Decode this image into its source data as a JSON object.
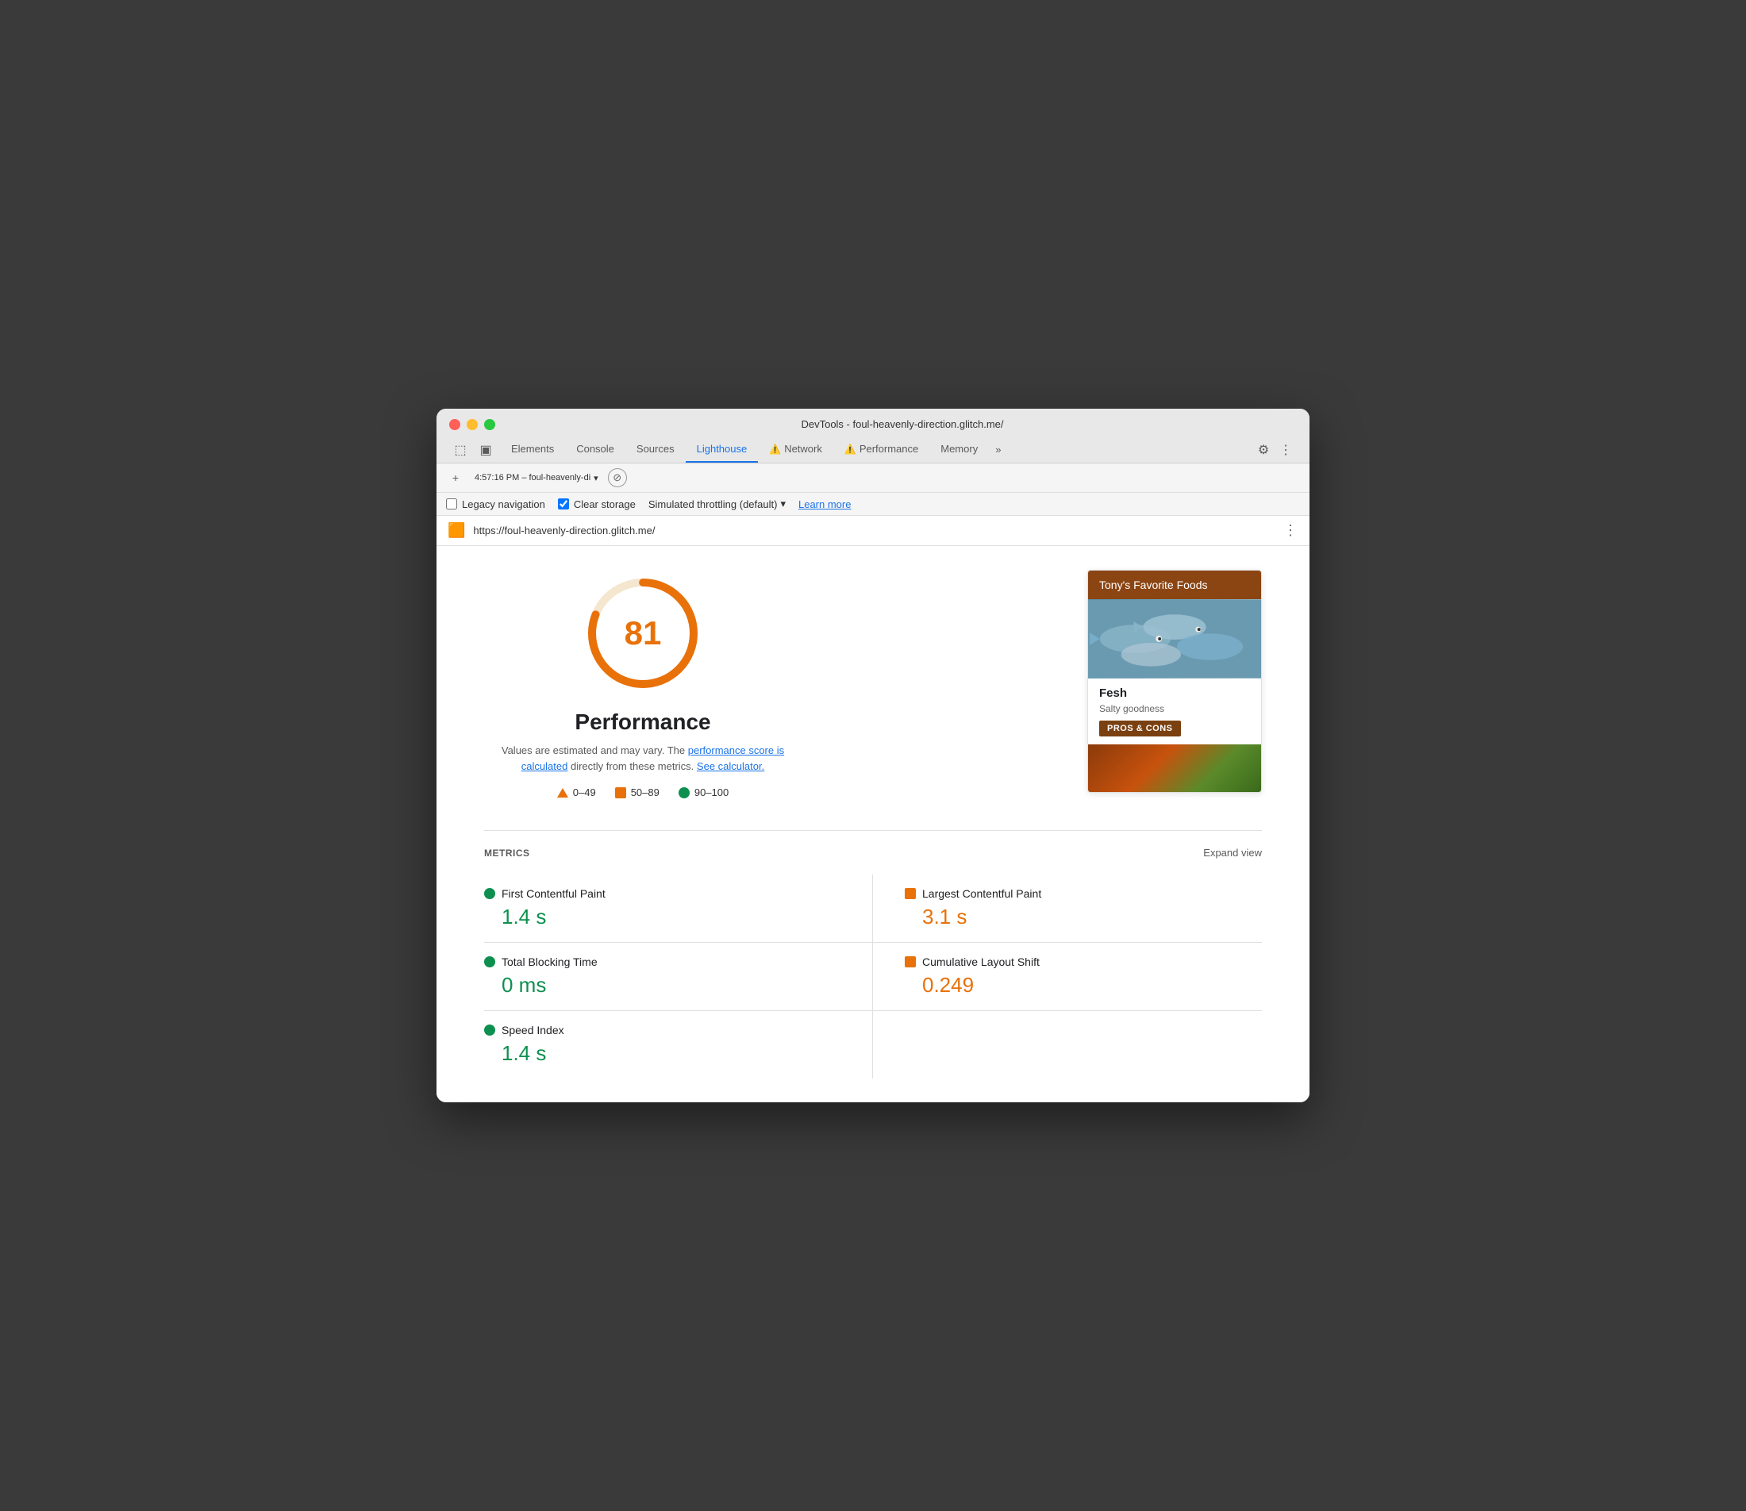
{
  "window": {
    "title": "DevTools - foul-heavenly-direction.glitch.me/"
  },
  "tabs": {
    "elements": "Elements",
    "console": "Console",
    "sources": "Sources",
    "lighthouse": "Lighthouse",
    "network": "Network",
    "performance": "Performance",
    "memory": "Memory",
    "more": "»"
  },
  "toolbar": {
    "session": "4:57:16 PM – foul-heavenly-di"
  },
  "options": {
    "legacy_navigation_label": "Legacy navigation",
    "clear_storage_label": "Clear storage",
    "throttling_label": "Simulated throttling (default)",
    "learn_more": "Learn more"
  },
  "url_bar": {
    "url": "https://foul-heavenly-direction.glitch.me/"
  },
  "score_section": {
    "score": "81",
    "title": "Performance",
    "description_text": "Values are estimated and may vary. The",
    "link1": "performance score is calculated",
    "description_mid": "directly from these metrics.",
    "link2": "See calculator.",
    "legend": [
      {
        "range": "0–49",
        "type": "triangle"
      },
      {
        "range": "50–89",
        "type": "square"
      },
      {
        "range": "90–100",
        "type": "circle"
      }
    ]
  },
  "food_card": {
    "header": "Tony's Favorite Foods",
    "item_name": "Fesh",
    "item_desc": "Salty goodness",
    "button_label": "PROS & CONS"
  },
  "metrics": {
    "label": "METRICS",
    "expand_view": "Expand view",
    "items": [
      {
        "name": "First Contentful Paint",
        "value": "1.4 s",
        "status": "green"
      },
      {
        "name": "Largest Contentful Paint",
        "value": "3.1 s",
        "status": "orange"
      },
      {
        "name": "Total Blocking Time",
        "value": "0 ms",
        "status": "green"
      },
      {
        "name": "Cumulative Layout Shift",
        "value": "0.249",
        "status": "orange"
      },
      {
        "name": "Speed Index",
        "value": "1.4 s",
        "status": "green"
      }
    ]
  },
  "colors": {
    "green": "#0d904f",
    "orange": "#e8710a",
    "blue": "#1a73e8",
    "gauge_bg": "#f5e6d0",
    "gauge_stroke": "#e8710a"
  }
}
